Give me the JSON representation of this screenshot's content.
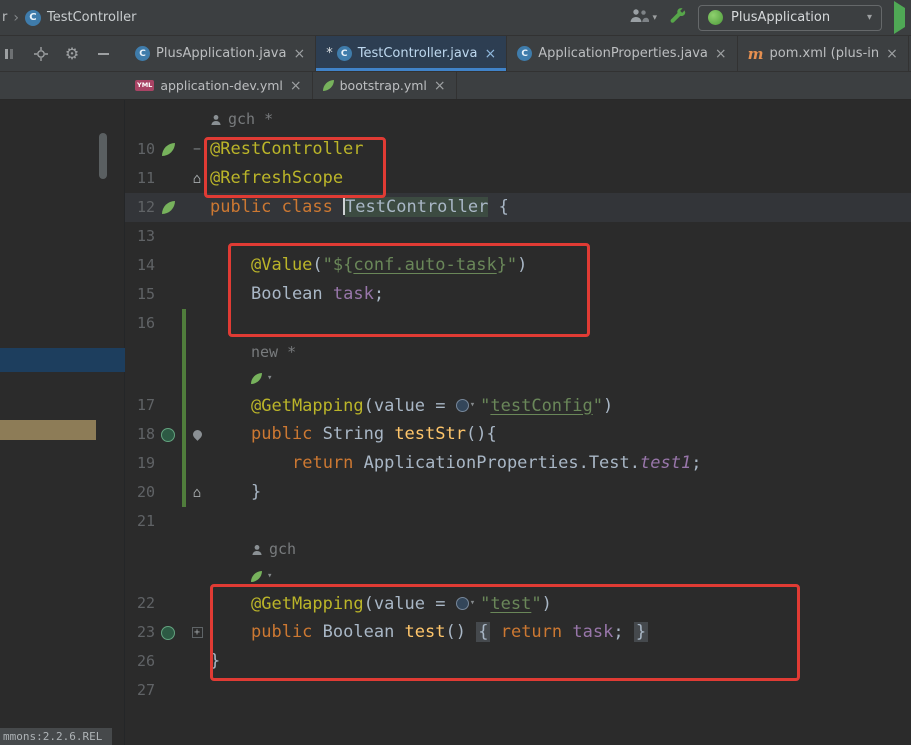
{
  "topbar": {
    "breadcrumb_prefix": "r",
    "breadcrumb_class": "TestController",
    "run_config": "PlusApplication"
  },
  "tabs_row1": [
    {
      "label": "PlusApplication.java",
      "icon": "class",
      "modified": false,
      "selected": false
    },
    {
      "label": "TestController.java",
      "icon": "class",
      "modified": true,
      "selected": true
    },
    {
      "label": "ApplicationProperties.java",
      "icon": "class",
      "modified": false,
      "selected": false
    },
    {
      "label": "pom.xml (plus-in",
      "icon": "maven",
      "modified": false,
      "selected": false
    }
  ],
  "tabs_row2": [
    {
      "label": "application-dev.yml",
      "icon": "yml"
    },
    {
      "label": "bootstrap.yml",
      "icon": "spring"
    }
  ],
  "status_fragment": "mmons:2.2.6.REL",
  "colors": {
    "accent_blue": "#4083c9",
    "annotation_red": "#e03b34",
    "run_green": "#4fa855",
    "selection_blue": "#1d3e5e",
    "selection_tan": "#8d7c57"
  },
  "editor": {
    "rows": [
      {
        "type": "hint",
        "icon": "person",
        "text": "gch *",
        "indent": 0
      },
      {
        "type": "code",
        "num": "10",
        "gicon": "leaf",
        "marker": "minus",
        "segs": [
          {
            "t": "@RestController",
            "c": "ann"
          }
        ]
      },
      {
        "type": "code",
        "num": "11",
        "marker": "home",
        "segs": [
          {
            "t": "@RefreshScope",
            "c": "ann"
          }
        ]
      },
      {
        "type": "code",
        "num": "12",
        "gicon": "leaf",
        "current": true,
        "segs": [
          {
            "t": "public class ",
            "c": "kw"
          },
          {
            "c": "caret"
          },
          {
            "t": "TestController",
            "c": "hl"
          },
          {
            "t": " {",
            "c": "def"
          }
        ]
      },
      {
        "type": "code",
        "num": "13",
        "segs": []
      },
      {
        "type": "code",
        "num": "14",
        "indent": 1,
        "segs": [
          {
            "t": "@Value",
            "c": "ann"
          },
          {
            "t": "(",
            "c": "def"
          },
          {
            "t": "\"${",
            "c": "str"
          },
          {
            "t": "conf.auto-task",
            "c": "strlink"
          },
          {
            "t": "}\"",
            "c": "str"
          },
          {
            "t": ")",
            "c": "def"
          }
        ]
      },
      {
        "type": "code",
        "num": "15",
        "indent": 1,
        "segs": [
          {
            "t": "Boolean ",
            "c": "def"
          },
          {
            "t": "task",
            "c": "field"
          },
          {
            "t": ";",
            "c": "def"
          }
        ]
      },
      {
        "type": "code",
        "num": "16",
        "changebar": true,
        "segs": []
      },
      {
        "type": "hint",
        "text": "new *",
        "indent": 1,
        "changebar": true
      },
      {
        "type": "springhint",
        "indent": 1,
        "changebar": true
      },
      {
        "type": "code",
        "num": "17",
        "indent": 1,
        "changebar": true,
        "segs": [
          {
            "t": "@GetMapping",
            "c": "ann"
          },
          {
            "t": "(value = ",
            "c": "def"
          },
          {
            "c": "urlicon"
          },
          {
            "t": "\"",
            "c": "str"
          },
          {
            "t": "testConfig",
            "c": "strlink"
          },
          {
            "t": "\"",
            "c": "str"
          },
          {
            "t": ")",
            "c": "def"
          }
        ]
      },
      {
        "type": "code",
        "num": "18",
        "indent": 1,
        "gicon": "mapping",
        "marker": "pin",
        "changebar": true,
        "segs": [
          {
            "t": "public ",
            "c": "kw"
          },
          {
            "t": "String ",
            "c": "def"
          },
          {
            "t": "testStr",
            "c": "method"
          },
          {
            "t": "(){",
            "c": "def"
          }
        ]
      },
      {
        "type": "code",
        "num": "19",
        "indent": 2,
        "changebar": true,
        "segs": [
          {
            "t": "return ",
            "c": "kw"
          },
          {
            "t": "ApplicationProperties.Test.",
            "c": "def"
          },
          {
            "t": "test1",
            "c": "sfield"
          },
          {
            "t": ";",
            "c": "def"
          }
        ]
      },
      {
        "type": "code",
        "num": "20",
        "indent": 1,
        "marker": "home",
        "changebar": true,
        "segs": [
          {
            "t": "}",
            "c": "def"
          }
        ]
      },
      {
        "type": "code",
        "num": "21",
        "segs": []
      },
      {
        "type": "hint",
        "icon": "person",
        "text": "gch",
        "indent": 1
      },
      {
        "type": "springhint",
        "indent": 1
      },
      {
        "type": "code",
        "num": "22",
        "indent": 1,
        "segs": [
          {
            "t": "@GetMapping",
            "c": "ann"
          },
          {
            "t": "(value = ",
            "c": "def"
          },
          {
            "c": "urlicon"
          },
          {
            "t": "\"",
            "c": "str"
          },
          {
            "t": "test",
            "c": "strlink"
          },
          {
            "t": "\"",
            "c": "str"
          },
          {
            "t": ")",
            "c": "def"
          }
        ]
      },
      {
        "type": "code",
        "num": "23",
        "indent": 1,
        "gicon": "mapping",
        "marker": "plus",
        "segs": [
          {
            "t": "public ",
            "c": "kw"
          },
          {
            "t": "Boolean ",
            "c": "def"
          },
          {
            "t": "test",
            "c": "method"
          },
          {
            "t": "() ",
            "c": "def"
          },
          {
            "t": "{",
            "c": "brace"
          },
          {
            "t": " ",
            "c": "def"
          },
          {
            "t": "return ",
            "c": "kw"
          },
          {
            "t": "task",
            "c": "field"
          },
          {
            "t": ";",
            "c": "def"
          },
          {
            "t": " ",
            "c": "def"
          },
          {
            "t": "}",
            "c": "brace"
          }
        ]
      },
      {
        "type": "code",
        "num": "26",
        "segs": [
          {
            "t": "}",
            "c": "def"
          }
        ]
      },
      {
        "type": "code",
        "num": "27",
        "segs": []
      }
    ]
  }
}
